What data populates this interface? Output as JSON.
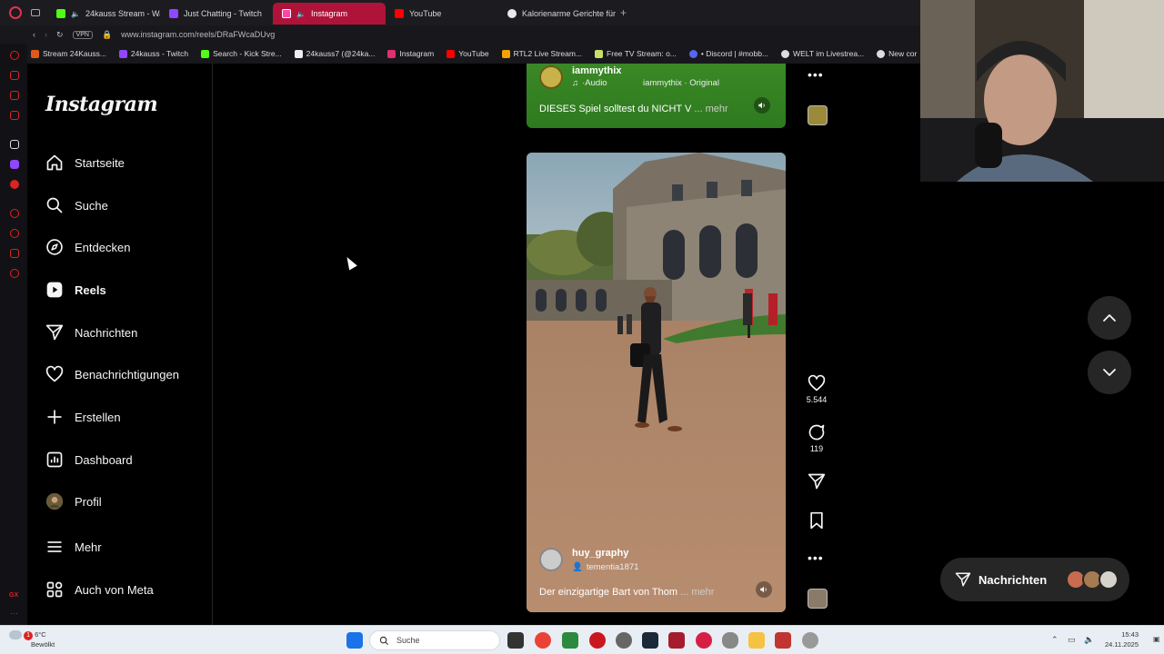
{
  "browser": {
    "tabs": [
      {
        "label": "24kauss Stream - Wa",
        "color": "#53fc18",
        "active": false
      },
      {
        "label": "Just Chatting - Twitch",
        "color": "#9146ff",
        "active": false
      },
      {
        "label": "Instagram",
        "color": "#e1306c",
        "active": true
      },
      {
        "label": "YouTube",
        "color": "#ff0000",
        "active": false
      },
      {
        "label": "Kalorienarme Gerichte für",
        "color": "#e9e9e9",
        "active": false
      }
    ],
    "new_tab_icon": "plus-icon",
    "address": "www.instagram.com/reels/DRaFWcaDUvg",
    "vpn_label": "VPN",
    "bookmarks": [
      {
        "label": "Stream 24Kauss...",
        "color": "#e05a1c"
      },
      {
        "label": "24kauss - Twitch",
        "color": "#9146ff"
      },
      {
        "label": "Search - Kick Stre...",
        "color": "#53fc18"
      },
      {
        "label": "24kauss7 (@24ka...",
        "color": "#eeeeee"
      },
      {
        "label": "Instagram",
        "color": "#e1306c"
      },
      {
        "label": "YouTube",
        "color": "#ff0000"
      },
      {
        "label": "RTL2 Live Stream...",
        "color": "#f5a300"
      },
      {
        "label": "Free TV Stream: o...",
        "color": "#c8e06a"
      },
      {
        "label": "• Discord | #mobb...",
        "color": "#5865f2"
      },
      {
        "label": "WELT im Livestrea...",
        "color": "#dddddd"
      },
      {
        "label": "New cor",
        "color": "#dddddd"
      }
    ]
  },
  "instagram": {
    "logo": "Instagram",
    "nav": [
      {
        "label": "Startseite",
        "icon": "home-icon"
      },
      {
        "label": "Suche",
        "icon": "search-icon"
      },
      {
        "label": "Entdecken",
        "icon": "compass-icon"
      },
      {
        "label": "Reels",
        "icon": "reels-icon",
        "active": true
      },
      {
        "label": "Nachrichten",
        "icon": "paper-plane-icon"
      },
      {
        "label": "Benachrichtigungen",
        "icon": "heart-icon"
      },
      {
        "label": "Erstellen",
        "icon": "plus-icon"
      },
      {
        "label": "Dashboard",
        "icon": "dashboard-icon"
      },
      {
        "label": "Profil",
        "icon": "profile-avatar-icon"
      },
      {
        "label": "Mehr",
        "icon": "menu-icon"
      },
      {
        "label": "Auch von Meta",
        "icon": "meta-apps-icon"
      }
    ],
    "reel_top": {
      "username": "iammythix",
      "audio_label": "·Audio",
      "audio_credit": "iammythix · Original",
      "caption": "DIESES Spiel solltest du NICHT V",
      "more": "... mehr"
    },
    "reel_main": {
      "username": "huy_graphy",
      "tagged": "tementia1871",
      "caption": "Der einzigartige Bart von Thom",
      "more": "... mehr"
    },
    "actions": {
      "likes": "5.544",
      "comments": "119"
    },
    "messages_pill": {
      "label": "Nachrichten"
    }
  },
  "taskbar": {
    "weather_temp": "6°C",
    "weather_desc": "Bewölkt",
    "weather_badge": "1",
    "search_placeholder": "Suche",
    "time": "15:43",
    "date": "24.11.2025"
  }
}
